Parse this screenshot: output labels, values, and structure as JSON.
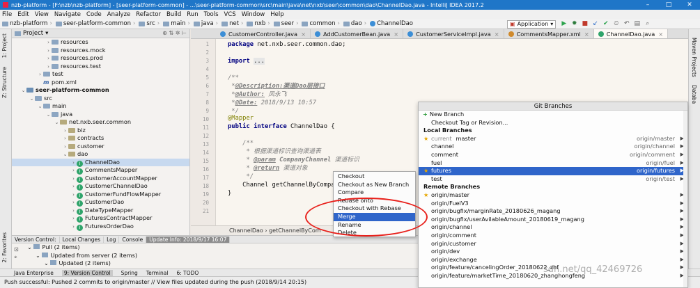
{
  "window": {
    "title": "nzb-platform - [F:\\nzb\\nzb-platform] - [seer-platform-common] - ...\\seer-platform-common\\src\\main\\java\\net\\nxb\\seer\\common\\dao\\ChannelDao.java - IntelliJ IDEA 2017.2",
    "controls": [
      "–",
      "□",
      "✕"
    ]
  },
  "menu": [
    "File",
    "Edit",
    "View",
    "Navigate",
    "Code",
    "Analyze",
    "Refactor",
    "Build",
    "Run",
    "Tools",
    "VCS",
    "Window",
    "Help"
  ],
  "navbar": {
    "crumbs": [
      "nzb-platform",
      "seer-platform-common",
      "src",
      "main",
      "java",
      "net",
      "nxb",
      "seer",
      "common",
      "dao",
      "ChannelDao"
    ],
    "run_config": "Application"
  },
  "left_strip": [
    "1: Project",
    "Z: Structure",
    "2: Favorites"
  ],
  "right_strip": [
    "Maven Projects",
    "Databa"
  ],
  "project": {
    "header": "Project",
    "rows": [
      {
        "label": "resources",
        "indent": 4,
        "arrow": "›",
        "icon": "folder"
      },
      {
        "label": "resources.mock",
        "indent": 4,
        "arrow": "›",
        "icon": "folder"
      },
      {
        "label": "resources.prod",
        "indent": 4,
        "arrow": "›",
        "icon": "folder"
      },
      {
        "label": "resources.test",
        "indent": 4,
        "arrow": "›",
        "icon": "folder"
      },
      {
        "label": "test",
        "indent": 3,
        "arrow": "›",
        "icon": "folder"
      },
      {
        "label": "pom.xml",
        "indent": 3,
        "arrow": "",
        "icon": "maven"
      },
      {
        "label": "seer-platform-common",
        "indent": 1,
        "arrow": "⌄",
        "icon": "module",
        "bold": true
      },
      {
        "label": "src",
        "indent": 2,
        "arrow": "⌄",
        "icon": "folder"
      },
      {
        "label": "main",
        "indent": 3,
        "arrow": "⌄",
        "icon": "folder"
      },
      {
        "label": "java",
        "indent": 4,
        "arrow": "⌄",
        "icon": "folder"
      },
      {
        "label": "net.nxb.seer.common",
        "indent": 5,
        "arrow": "⌄",
        "icon": "package"
      },
      {
        "label": "biz",
        "indent": 6,
        "arrow": "›",
        "icon": "package"
      },
      {
        "label": "contracts",
        "indent": 6,
        "arrow": "›",
        "icon": "package"
      },
      {
        "label": "customer",
        "indent": 6,
        "arrow": "›",
        "icon": "package"
      },
      {
        "label": "dao",
        "indent": 6,
        "arrow": "⌄",
        "icon": "package"
      },
      {
        "label": "ChannelDao",
        "indent": 7,
        "arrow": "›",
        "icon": "class",
        "selected": true
      },
      {
        "label": "CommentsMapper",
        "indent": 7,
        "arrow": "›",
        "icon": "class"
      },
      {
        "label": "CustomerAccountMapper",
        "indent": 7,
        "arrow": "›",
        "icon": "class"
      },
      {
        "label": "CustomerChannelDao",
        "indent": 7,
        "arrow": "›",
        "icon": "class"
      },
      {
        "label": "CustomerFundFlowMapper",
        "indent": 7,
        "arrow": "›",
        "icon": "class"
      },
      {
        "label": "CustomerDao",
        "indent": 7,
        "arrow": "›",
        "icon": "class"
      },
      {
        "label": "DateTypeMapper",
        "indent": 7,
        "arrow": "›",
        "icon": "class"
      },
      {
        "label": "FuturesContractMapper",
        "indent": 7,
        "arrow": "›",
        "icon": "class"
      },
      {
        "label": "FuturesOrderDao",
        "indent": 7,
        "arrow": "›",
        "icon": "class"
      }
    ]
  },
  "editor": {
    "tabs": [
      {
        "label": "CustomerController.java",
        "active": false
      },
      {
        "label": "AddCustomerBean.java",
        "active": false
      },
      {
        "label": "CustomerServiceImpl.java",
        "active": false
      },
      {
        "label": "CommentsMapper.xml",
        "active": false
      },
      {
        "label": "ChannelDao.java",
        "active": true
      }
    ],
    "line_numbers": [
      "1",
      "2",
      "3",
      "4",
      "5",
      "6",
      "7",
      "8",
      "9",
      "10",
      "11",
      "12",
      "13",
      "14",
      "15",
      "16",
      "17",
      "18",
      "19",
      "20",
      "21"
    ],
    "code": {
      "l1a": "package ",
      "l1b": "net.nxb.seer.common.dao;",
      "l3a": "import ",
      "l3b": "...",
      "l5": "/**",
      "l6a": " *",
      "l6b": "@Description:",
      "l6c": "渠道Dao层接口",
      "l7a": " *",
      "l7b": "@Author:",
      "l7c": " 凤永飞",
      "l8a": " *",
      "l8b": "@Date:",
      "l8c": " 2018/9/13 10:57",
      "l9": " */",
      "l10": "@Mapper",
      "l11a": "public interface ",
      "l11b": "ChannelDao {",
      "l13": "    /**",
      "l14": "     * 根据渠道标识查询渠道表",
      "l15a": "     * ",
      "l15b": "@param",
      "l15c": " CompanyChannel",
      "l15d": " 渠道标识",
      "l16a": "     * ",
      "l16b": "@return",
      "l16c": " 渠道对象",
      "l17": "     */",
      "l18": "    Channel getChannelByCompanyChannel(String C",
      "l19": "}"
    },
    "breadcrumb": "ChannelDao  ›  getChannelByCom"
  },
  "context_menu": {
    "items": [
      "Checkout",
      "Checkout as New Branch",
      "Compare",
      "Rebase onto",
      "Checkout with Rebase",
      "Merge",
      "Rename",
      "Delete"
    ],
    "selected": "Merge"
  },
  "git_branches": {
    "title": "Git Branches",
    "actions": [
      "New Branch",
      "Checkout Tag or Revision..."
    ],
    "local_header": "Local Branches",
    "local": [
      {
        "name": "master",
        "current_label": "current",
        "tracking": "origin/master",
        "star": true
      },
      {
        "name": "channel",
        "tracking": "origin/channel"
      },
      {
        "name": "comment",
        "tracking": "origin/comment"
      },
      {
        "name": "fuel",
        "tracking": "origin/fuel"
      },
      {
        "name": "futures",
        "tracking": "origin/futures",
        "star": true,
        "selected": true
      },
      {
        "name": "test",
        "tracking": "origin/test"
      }
    ],
    "remote_header": "Remote Branches",
    "remote": [
      {
        "name": "origin/master",
        "star": true
      },
      {
        "name": "origin/FuelV3"
      },
      {
        "name": "origin/bugfix/marginRate_20180626_magang"
      },
      {
        "name": "origin/bugfix/userAvilableAmount_20180619_magang"
      },
      {
        "name": "origin/channel"
      },
      {
        "name": "origin/comment"
      },
      {
        "name": "origin/customer"
      },
      {
        "name": "origin/dev"
      },
      {
        "name": "origin/exchange"
      },
      {
        "name": "origin/feature/cancelingOrder_20180622_zhf"
      },
      {
        "name": "origin/feature/marketTime_20180620_zhanghongfeng"
      }
    ]
  },
  "version_control": {
    "tabs": [
      "Version Control:",
      "Local Changes",
      "Log",
      "Console",
      "Update Info: 2018/9/17 16:07"
    ],
    "rows": [
      {
        "label": "Pull (2 items)",
        "indent": 1
      },
      {
        "label": "Updated from server (2 items)",
        "indent": 2
      },
      {
        "label": "Updated (2 items)",
        "indent": 3
      }
    ]
  },
  "tool_windows": [
    "Java Enterprise",
    "9: Version Control",
    "Spring",
    "Terminal",
    "6: TODO"
  ],
  "status": "Push successful: Pushed 2 commits to origin/master // View files updated during the push (2018/9/14 20:15)",
  "watermark": "sdn.net/qq_42469726",
  "colors": {
    "title_bar": "#1f76c8",
    "selection": "#2f65ca",
    "highlight_circle": "#e8201b"
  }
}
